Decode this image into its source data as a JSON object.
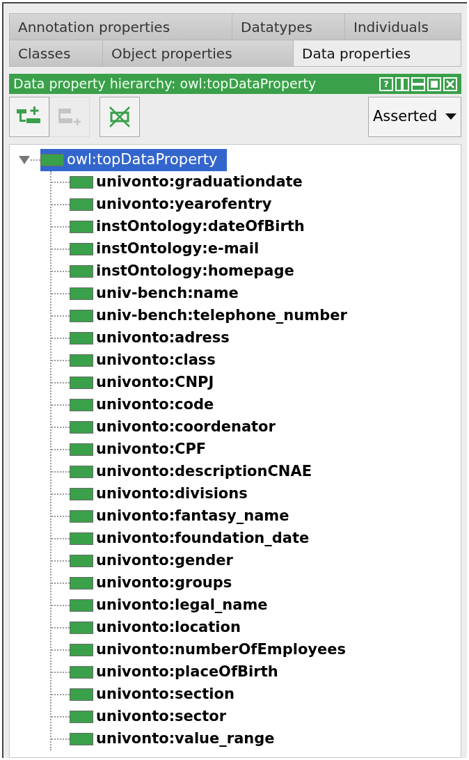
{
  "tabs_top": [
    {
      "label": "Annotation properties",
      "selected": false
    },
    {
      "label": "Datatypes",
      "selected": false
    },
    {
      "label": "Individuals",
      "selected": false
    }
  ],
  "tabs_bottom": [
    {
      "label": "Classes",
      "selected": false
    },
    {
      "label": "Object properties",
      "selected": false
    },
    {
      "label": "Data properties",
      "selected": true
    }
  ],
  "view_header": {
    "title": "Data property hierarchy: owl:topDataProperty",
    "help_glyph": "?"
  },
  "toolbar": [
    {
      "kind": "add_sub",
      "disabled": false
    },
    {
      "kind": "add_sibling",
      "disabled": true
    },
    {
      "kind": "delete",
      "disabled": false
    }
  ],
  "mode_dropdown": {
    "value": "Asserted"
  },
  "tree": [
    {
      "label": "owl:topDataProperty",
      "selected": true,
      "expanded": true,
      "children": [
        {
          "label": "univonto:graduationdate",
          "selected": false
        },
        {
          "label": "univonto:yearofentry",
          "selected": false
        },
        {
          "label": "instOntology:dateOfBirth",
          "selected": false
        },
        {
          "label": "instOntology:e-mail",
          "selected": false
        },
        {
          "label": "instOntology:homepage",
          "selected": false
        },
        {
          "label": "univ-bench:name",
          "selected": false
        },
        {
          "label": "univ-bench:telephone_number",
          "selected": false
        },
        {
          "label": "univonto:adress",
          "selected": false
        },
        {
          "label": "univonto:class",
          "selected": false
        },
        {
          "label": "univonto:CNPJ",
          "selected": false
        },
        {
          "label": "univonto:code",
          "selected": false
        },
        {
          "label": "univonto:coordenator",
          "selected": false
        },
        {
          "label": "univonto:CPF",
          "selected": false
        },
        {
          "label": "univonto:descriptionCNAE",
          "selected": false
        },
        {
          "label": "univonto:divisions",
          "selected": false
        },
        {
          "label": "univonto:fantasy_name",
          "selected": false
        },
        {
          "label": "univonto:foundation_date",
          "selected": false
        },
        {
          "label": "univonto:gender",
          "selected": false
        },
        {
          "label": "univonto:groups",
          "selected": false
        },
        {
          "label": "univonto:legal_name",
          "selected": false
        },
        {
          "label": "univonto:location",
          "selected": false
        },
        {
          "label": "univonto:numberOfEmployees",
          "selected": false
        },
        {
          "label": "univonto:placeOfBirth",
          "selected": false
        },
        {
          "label": "univonto:section",
          "selected": false
        },
        {
          "label": "univonto:sector",
          "selected": false
        },
        {
          "label": "univonto:value_range",
          "selected": false
        }
      ]
    }
  ]
}
